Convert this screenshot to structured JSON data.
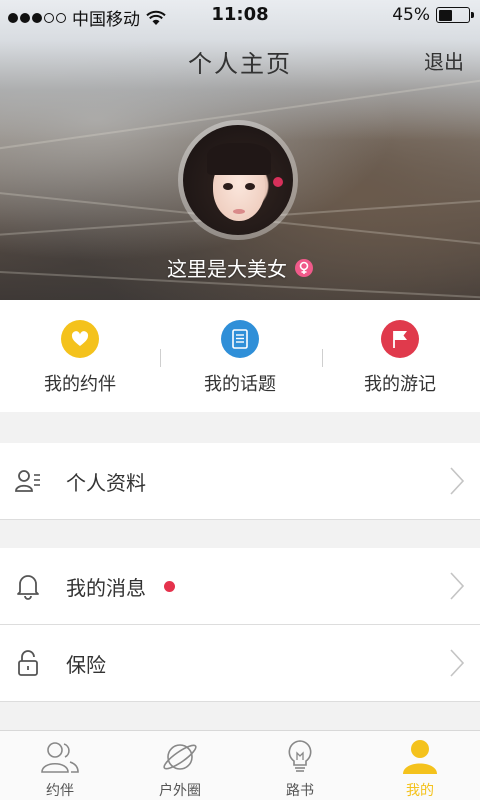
{
  "status_bar": {
    "carrier": "中国移动",
    "time": "11:08",
    "battery": "45%",
    "battery_level": 0.45,
    "signal_bars": 3,
    "signal_total": 5
  },
  "header": {
    "title": "个人主页",
    "logout_label": "退出"
  },
  "profile": {
    "username": "这里是大美女",
    "gender_icon": "female-icon"
  },
  "quick_actions": [
    {
      "label": "我的约伴",
      "icon": "heart-icon",
      "color": "#f4c21c"
    },
    {
      "label": "我的话题",
      "icon": "document-icon",
      "color": "#2f8fd8"
    },
    {
      "label": "我的游记",
      "icon": "flag-icon",
      "color": "#e03a4c"
    }
  ],
  "menu": {
    "profile_label": "个人资料",
    "messages_label": "我的消息",
    "insurance_label": "保险"
  },
  "tabbar": {
    "tabs": [
      {
        "label": "约伴",
        "icon": "people-icon"
      },
      {
        "label": "户外圈",
        "icon": "planet-icon"
      },
      {
        "label": "路书",
        "icon": "lightbulb-icon"
      },
      {
        "label": "我的",
        "icon": "person-icon",
        "active": true
      }
    ],
    "active_color": "#f4c21c"
  }
}
